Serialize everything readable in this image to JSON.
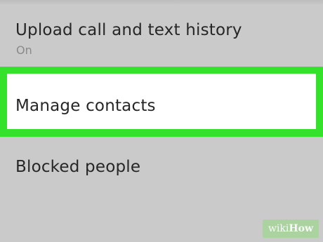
{
  "settings": {
    "upload_history": {
      "title": "Upload call and text history",
      "status": "On"
    },
    "manage_contacts": {
      "title": "Manage contacts"
    },
    "blocked_people": {
      "title": "Blocked people"
    }
  },
  "highlight": {
    "color": "#34e22c"
  },
  "watermark": {
    "prefix": "wiki",
    "suffix": "How"
  }
}
